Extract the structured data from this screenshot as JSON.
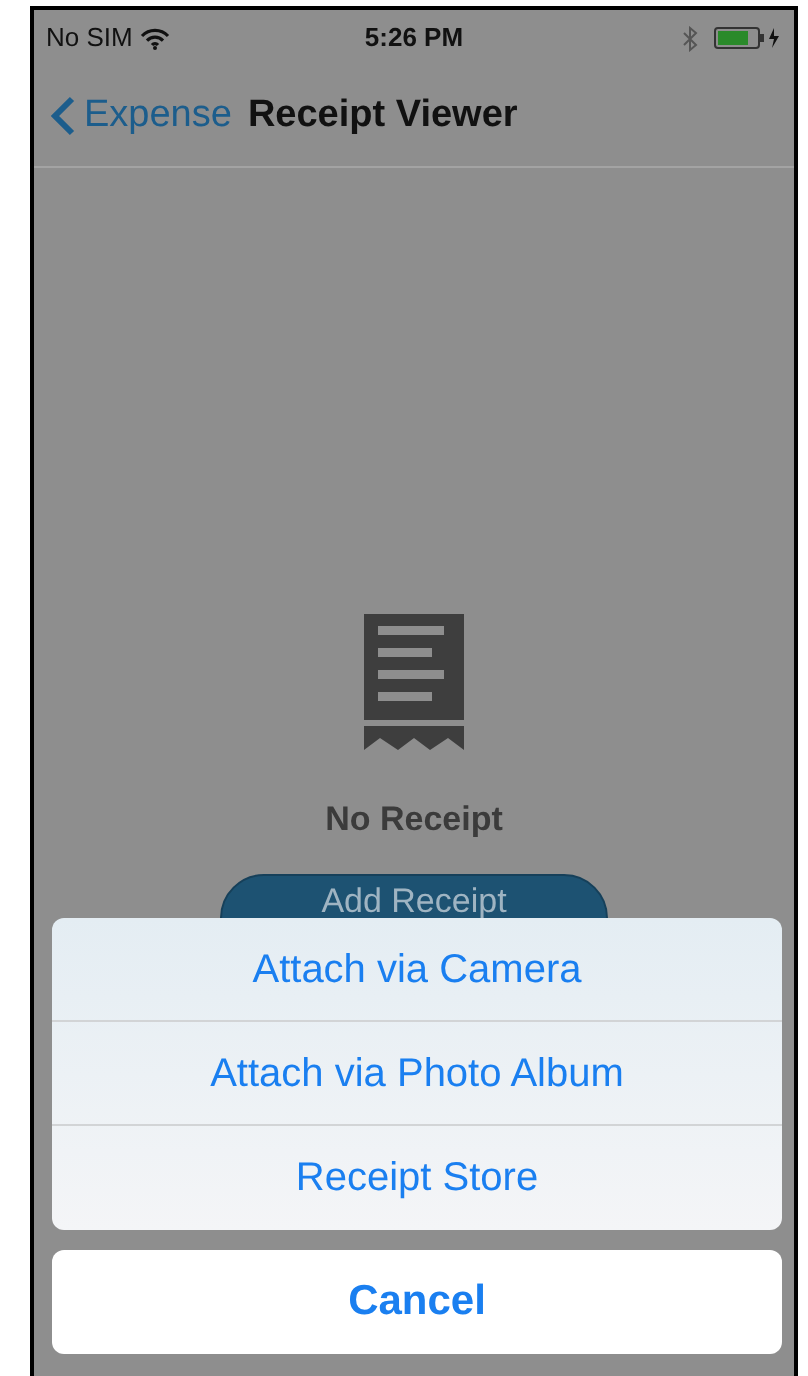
{
  "status_bar": {
    "carrier": "No SIM",
    "time": "5:26 PM"
  },
  "nav_bar": {
    "back_label": "Expense",
    "title": "Receipt Viewer"
  },
  "empty_state": {
    "message": "No Receipt",
    "button": "Add Receipt"
  },
  "action_sheet": {
    "options": [
      {
        "label": "Attach via Camera"
      },
      {
        "label": "Attach via Photo Album"
      },
      {
        "label": "Receipt Store"
      }
    ],
    "cancel": "Cancel"
  }
}
